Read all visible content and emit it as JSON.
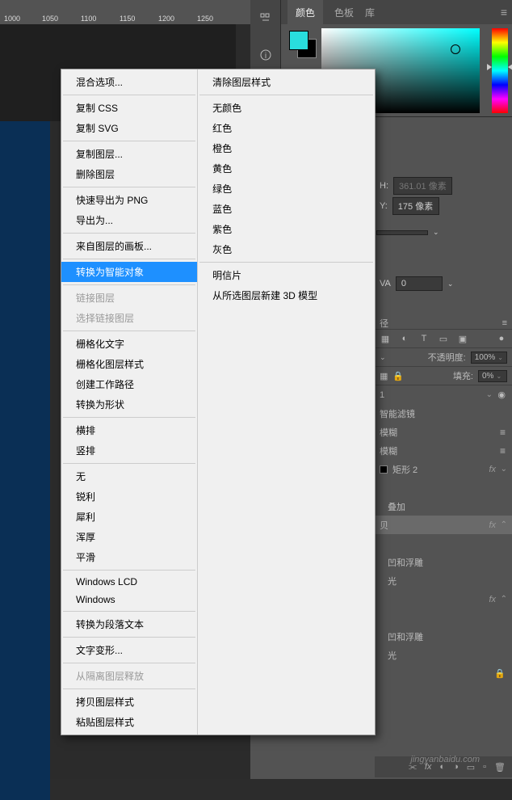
{
  "ruler": {
    "marks": [
      "1000",
      "1050",
      "1100",
      "1150",
      "1200",
      "1250"
    ]
  },
  "color_tabs": {
    "t1": "颜色",
    "t2": "色板",
    "t3": "库"
  },
  "swatches": {
    "fg": "#29dddd",
    "bg": "#000000"
  },
  "properties": {
    "H_label": "H:",
    "H_value": "361.01 像素",
    "Y_label": "Y:",
    "Y_value": "175 像素",
    "VA_label": "VA",
    "VA_value": "0"
  },
  "layer_opts": {
    "opacity_label": "不透明度:",
    "opacity_value": "100%",
    "fill_label": "填充:",
    "fill_value": "0%"
  },
  "layers": {
    "i1": "智能滤镜",
    "i2": "模糊",
    "i3": "模糊",
    "i4": "矩形 2",
    "i5": "叠加",
    "i6": "贝",
    "i7": "凹和浮雕",
    "i8": "光",
    "i9": "凹和浮雕",
    "i10": "光",
    "top_num": "1",
    "path_label": "径"
  },
  "watermark": "jingyanbaidu.com",
  "menu1": {
    "blending_options": "混合选项...",
    "copy_css": "复制 CSS",
    "copy_svg": "复制 SVG",
    "duplicate_layer": "复制图层...",
    "delete_layer": "删除图层",
    "quick_export_png": "快速导出为 PNG",
    "export_as": "导出为...",
    "artboard_from_layers": "来自图层的画板...",
    "convert_to_smart": "转换为智能对象",
    "link_layers": "链接图层",
    "select_linked": "选择链接图层",
    "rasterize_type": "栅格化文字",
    "rasterize_style": "栅格化图层样式",
    "create_work_path": "创建工作路径",
    "convert_to_shape": "转换为形状",
    "horizontal": "横排",
    "vertical": "竖排",
    "none": "无",
    "sharp": "锐利",
    "crisp": "犀利",
    "strong": "浑厚",
    "smooth": "平滑",
    "windows_lcd": "Windows LCD",
    "windows": "Windows",
    "to_paragraph": "转换为段落文本",
    "warp_text": "文字变形...",
    "release_iso": "从隔离图层释放",
    "copy_style": "拷贝图层样式",
    "paste_style": "粘贴图层样式"
  },
  "menu2": {
    "clear_style": "清除图层样式",
    "no_color": "无颜色",
    "red": "红色",
    "orange": "橙色",
    "yellow": "黄色",
    "green": "绿色",
    "blue": "蓝色",
    "purple": "紫色",
    "gray": "灰色",
    "postcard": "明信片",
    "new_3d": "从所选图层新建 3D 模型"
  }
}
